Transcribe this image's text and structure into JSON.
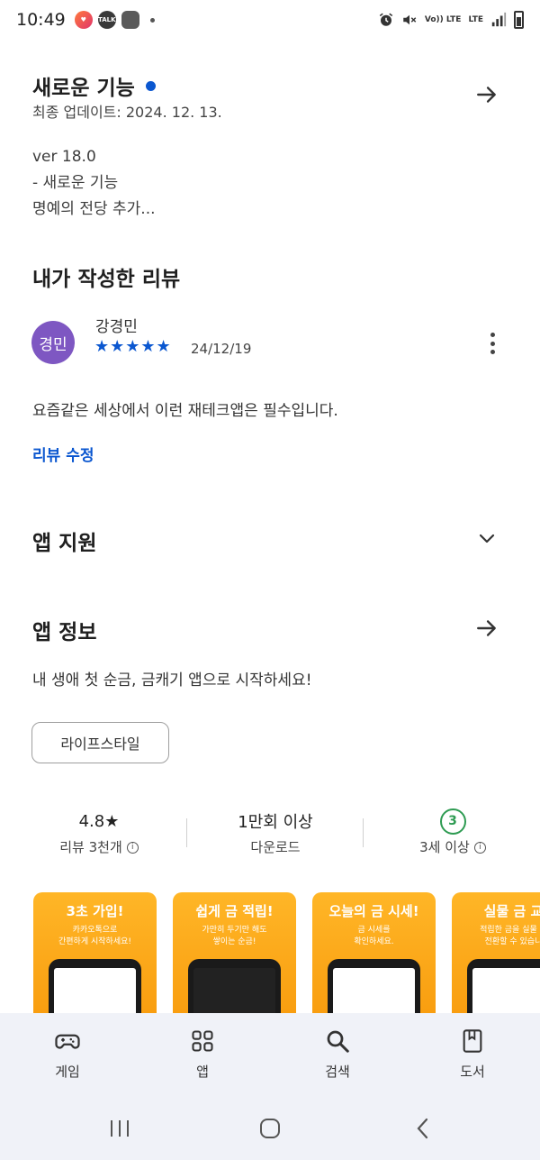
{
  "status_bar": {
    "time": "10:49",
    "talk_label": "TALK",
    "volte_label": "Vo)) LTE",
    "lte_label": "LTE"
  },
  "whats_new": {
    "title": "새로운 기능",
    "updated": "최종 업데이트: 2024. 12. 13.",
    "notes": [
      "ver 18.0",
      "- 새로운 기능",
      "명예의 전당 추가..."
    ]
  },
  "my_review": {
    "heading": "내가 작성한 리뷰",
    "avatar_text": "경민",
    "reviewer": "강경민",
    "stars": "★★★★★",
    "rating": 5,
    "date": "24/12/19",
    "text": "요즘같은 세상에서 이런 재테크앱은 필수입니다.",
    "edit_label": "리뷰 수정"
  },
  "app_support": {
    "heading": "앱 지원"
  },
  "app_info": {
    "heading": "앱 정보",
    "description": "내 생애 첫 순금, 금캐기 앱으로 시작하세요!",
    "category": "라이프스타일"
  },
  "stats": {
    "rating_value": "4.8★",
    "rating_label": "리뷰 3천개",
    "downloads_value": "1만회 이상",
    "downloads_label": "다운로드",
    "age_value": "3",
    "age_label": "3세 이상",
    "info_glyph": "i"
  },
  "screenshots": [
    {
      "title": "3초 가입!",
      "sub1": "카카오톡으로",
      "sub2": "간편하게 시작하세요!"
    },
    {
      "title": "쉽게 금 적립!",
      "sub1": "가만히 두기만 해도",
      "sub2": "쌓이는 순금!"
    },
    {
      "title": "오늘의 금 시세!",
      "sub1": "금 시세를",
      "sub2": "확인하세요."
    },
    {
      "title": "실물 금 교",
      "sub1": "적립한 금을 실물 금",
      "sub2": "전환할 수 있습니"
    }
  ],
  "bottom_nav": {
    "games": "게임",
    "apps": "앱",
    "search": "검색",
    "books": "도서"
  },
  "colors": {
    "accent": "#0b57d0",
    "avatar": "#7e57c2",
    "age_badge": "#2e9b52",
    "screenshot_bg": "#f89b0d",
    "nav_bg": "#f0f2f8"
  }
}
